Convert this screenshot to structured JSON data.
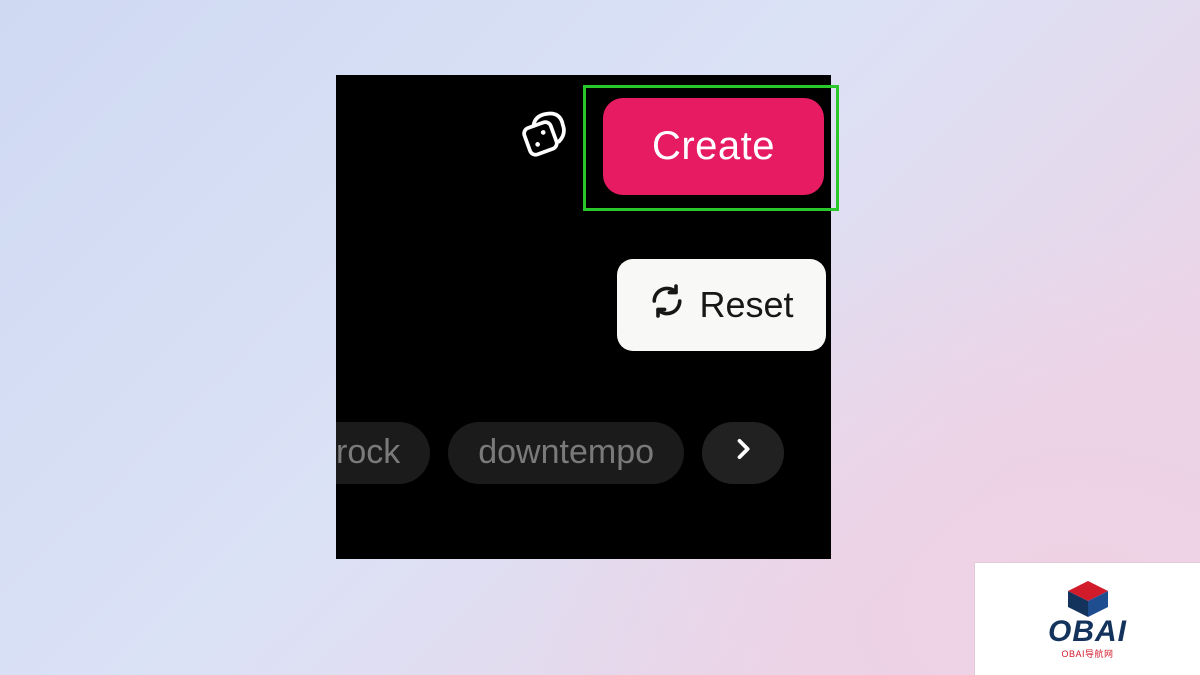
{
  "buttons": {
    "create_label": "Create",
    "reset_label": "Reset"
  },
  "tags": {
    "first": "rock",
    "second": "downtempo"
  },
  "logo": {
    "word": "OBAI",
    "sub": "OBAI导航网"
  },
  "colors": {
    "accent": "#e71b62",
    "highlight": "#29c729"
  }
}
